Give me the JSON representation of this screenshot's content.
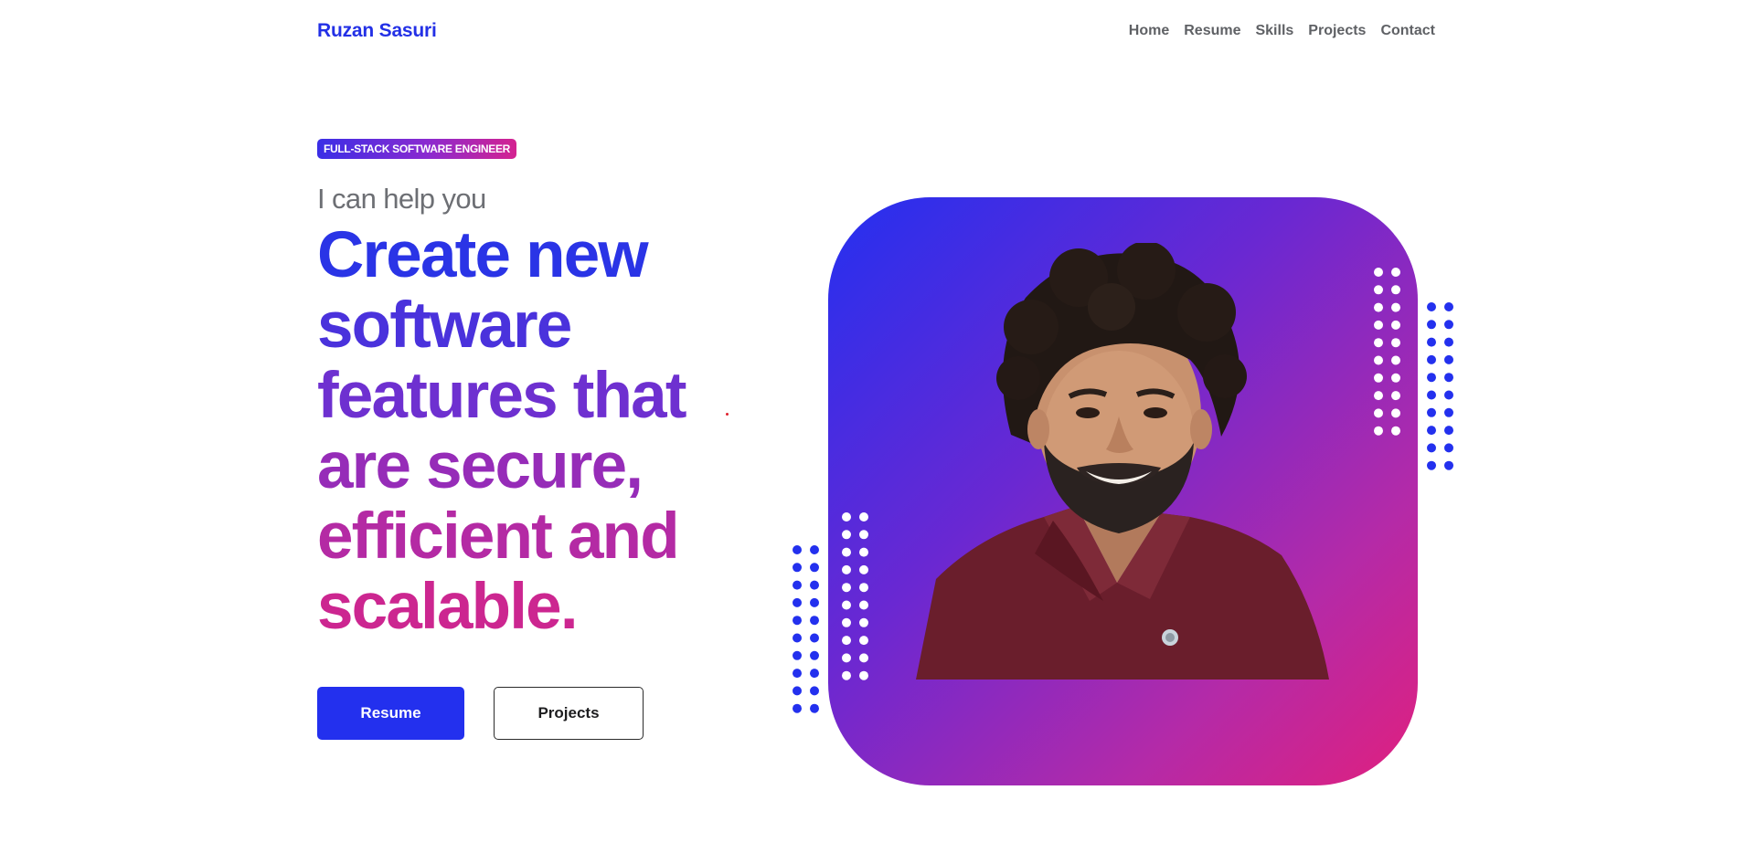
{
  "site": {
    "brand": "Ruzan Sasuri"
  },
  "nav": {
    "items": [
      "Home",
      "Resume",
      "Skills",
      "Projects",
      "Contact"
    ]
  },
  "hero": {
    "badge": "FULL-STACK SOFTWARE ENGINEER",
    "subtitle": "I can help you",
    "headline_lines": [
      "Create new",
      "software",
      "features that",
      "are secure,",
      "efficient and",
      "scalable."
    ],
    "headline_colors": [
      "#2a34e6",
      "#4a32dc",
      "#6e30d0",
      "#962cb8",
      "#b42aa4",
      "#cc2690"
    ],
    "primary_button": "Resume",
    "secondary_button": "Projects"
  },
  "colors": {
    "brand": "#2330e6",
    "accent_blue": "#2330ee",
    "accent_pink": "#e0207e",
    "nav_text": "#5f6165"
  },
  "icons": {
    "portrait": "person-photo-icon",
    "dot_patterns": "decorative-dots"
  }
}
